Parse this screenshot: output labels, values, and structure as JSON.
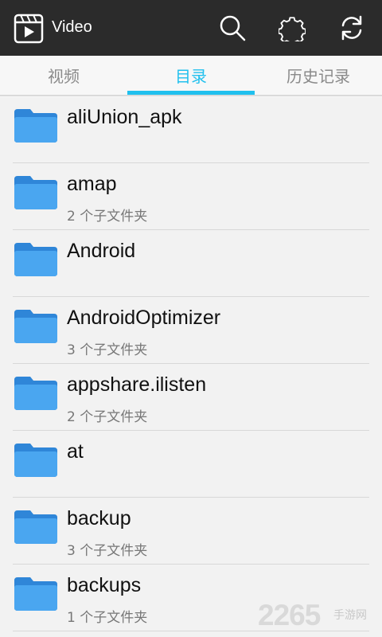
{
  "header": {
    "title": "Video",
    "icons": [
      "video-app-icon",
      "search-icon",
      "gear-icon",
      "refresh-icon"
    ]
  },
  "tabs": [
    {
      "label": "视频",
      "active": false
    },
    {
      "label": "目录",
      "active": true
    },
    {
      "label": "历史记录",
      "active": false
    }
  ],
  "colors": {
    "accent": "#20c0ee",
    "topbar": "#2b2b2b",
    "folder": "#3d9ae8"
  },
  "folders": [
    {
      "name": "aliUnion_apk",
      "meta": ""
    },
    {
      "name": "amap",
      "meta": "2 个子文件夹"
    },
    {
      "name": "Android",
      "meta": ""
    },
    {
      "name": "AndroidOptimizer",
      "meta": "3 个子文件夹"
    },
    {
      "name": "appshare.ilisten",
      "meta": "2 个子文件夹"
    },
    {
      "name": "at",
      "meta": ""
    },
    {
      "name": "backup",
      "meta": "3 个子文件夹"
    },
    {
      "name": "backups",
      "meta": "1 个子文件夹"
    }
  ],
  "watermark": {
    "number": "2265",
    "text": "手游网"
  }
}
